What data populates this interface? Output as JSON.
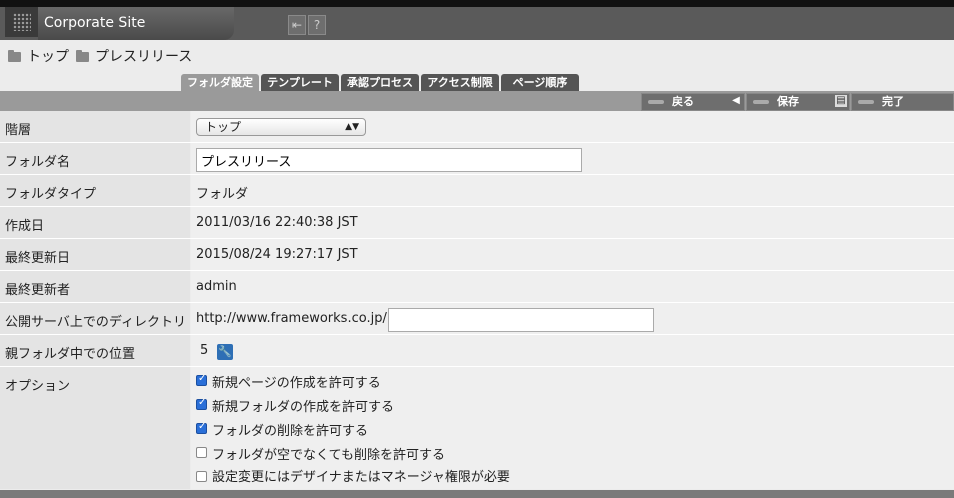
{
  "header": {
    "site_title": "Corporate Site",
    "icons": [
      "logout-icon",
      "help-icon"
    ]
  },
  "breadcrumb": [
    "トップ",
    "プレスリリース"
  ],
  "tabs": [
    "フォルダ設定",
    "テンプレート",
    "承認プロセス",
    "アクセス制限",
    "ページ順序"
  ],
  "toolbar": {
    "back_label": "戻る",
    "save_label": "保存",
    "done_label": "完了"
  },
  "form": {
    "hierarchy_label": "階層",
    "hierarchy_value": "トップ",
    "folder_name_label": "フォルダ名",
    "folder_name_value": "プレスリリース",
    "folder_type_label": "フォルダタイプ",
    "folder_type_value": "フォルダ",
    "created_label": "作成日",
    "created_value": "2011/03/16 22:40:38 JST",
    "updated_label": "最終更新日",
    "updated_value": "2015/08/24 19:27:17 JST",
    "updater_label": "最終更新者",
    "updater_value": "admin",
    "directory_label": "公開サーバ上でのディレクトリ",
    "directory_prefix": "http://www.frameworks.co.jp/",
    "directory_value": "",
    "position_label": "親フォルダ中での位置",
    "position_value": "5",
    "options_label": "オプション",
    "options": [
      {
        "label": "新規ページの作成を許可する",
        "checked": true
      },
      {
        "label": "新規フォルダの作成を許可する",
        "checked": true
      },
      {
        "label": "フォルダの削除を許可する",
        "checked": true
      },
      {
        "label": "フォルダが空でなくても削除を許可する",
        "checked": false
      },
      {
        "label": "設定変更にはデザイナまたはマネージャ権限が必要",
        "checked": false
      }
    ]
  }
}
